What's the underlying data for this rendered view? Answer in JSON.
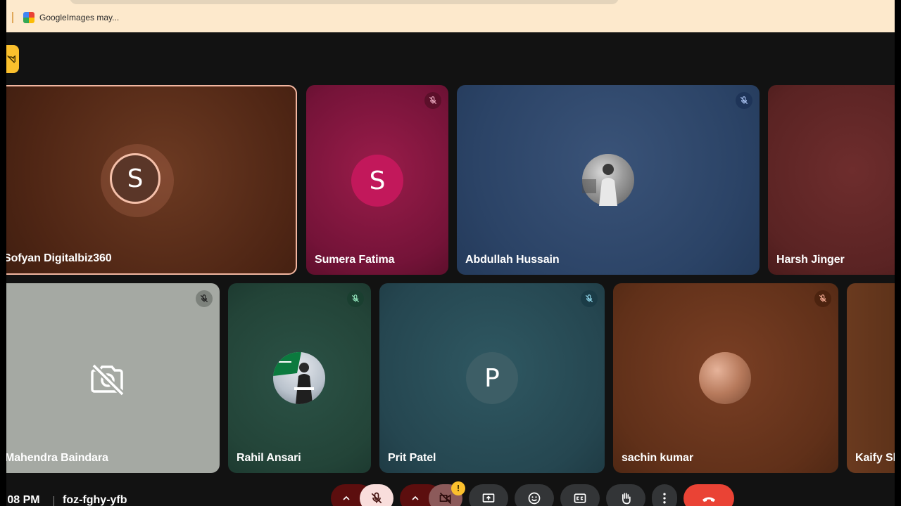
{
  "browser": {
    "tab_title": "GoogleImages may..."
  },
  "participants": [
    {
      "name": "Sofyan Digitalbiz360",
      "initial": "S",
      "muted": false
    },
    {
      "name": "Sumera Fatima",
      "initial": "S",
      "muted": true
    },
    {
      "name": "Abdullah Hussain",
      "initial": "",
      "muted": true
    },
    {
      "name": "Harsh Jinger",
      "initial": "",
      "muted": false
    },
    {
      "name": "Mahendra Baindara",
      "initial": "",
      "muted": true
    },
    {
      "name": "Rahil Ansari",
      "initial": "",
      "muted": true
    },
    {
      "name": "Prit Patel",
      "initial": "P",
      "muted": true
    },
    {
      "name": "sachin kumar",
      "initial": "",
      "muted": true
    },
    {
      "name": "Kaify Sh",
      "initial": "",
      "muted": false
    }
  ],
  "meeting": {
    "time": ":08 PM",
    "code": "foz-fghy-yfb",
    "warning_badge": "!"
  },
  "colors": {
    "leave_red": "#ea4335",
    "pin_yellow": "#fbc02d",
    "active_speaker_border": "#f2b6a0"
  },
  "icons": {
    "mic": "mic-off-icon",
    "camera": "video-off-icon",
    "present": "present-screen-icon",
    "emoji": "emoji-icon",
    "captions": "captions-icon",
    "hand": "raise-hand-icon",
    "more": "more-vert-icon",
    "leave": "call-end-icon"
  }
}
